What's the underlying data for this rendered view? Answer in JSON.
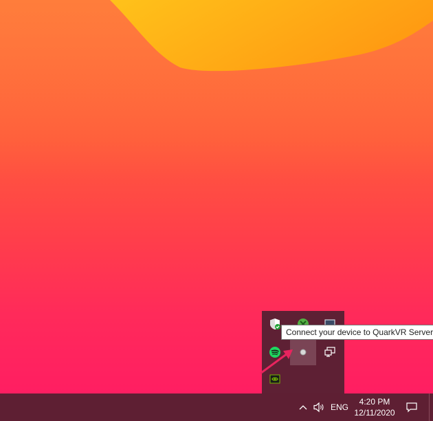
{
  "tooltip": {
    "text": "Connect your device to QuarkVR Server"
  },
  "overflow_panel": {
    "icons": [
      "windows-security-icon",
      "xbox-icon",
      "monitor-icon",
      "spotify-icon",
      "quarkvr-icon",
      "network-icon",
      "nvidia-icon"
    ]
  },
  "taskbar": {
    "language": "ENG",
    "time": "4:20 PM",
    "date": "12/11/2020"
  },
  "colors": {
    "taskbar": "#5e1f33",
    "tray_panel": "#5e2034",
    "accent_arrow": "#e8245e",
    "spotify_green": "#1ed760",
    "nvidia_green": "#76b900"
  }
}
